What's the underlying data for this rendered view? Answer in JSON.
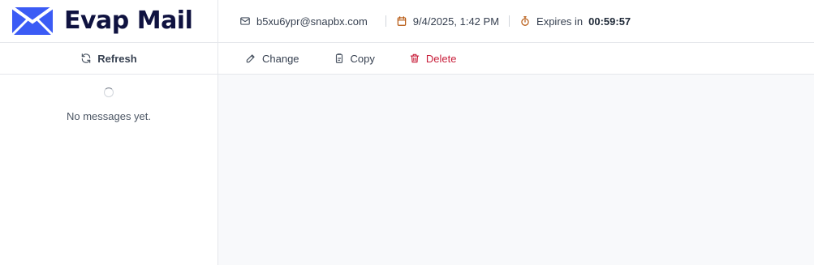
{
  "brand": {
    "name": "Evap Mail",
    "logo_icon": "envelope-logo-icon",
    "logo_color": "#3b5bf5"
  },
  "header": {
    "email": "b5xu6ypr@snapbx.com",
    "created": "9/4/2025, 1:42 PM",
    "expires_label": "Expires in",
    "expires_countdown": "00:59:57",
    "calendar_color": "#b45309",
    "timer_color": "#b45309"
  },
  "sidebar": {
    "refresh_label": "Refresh",
    "empty_text": "No messages yet."
  },
  "toolbar": {
    "change_label": "Change",
    "copy_label": "Copy",
    "delete_label": "Delete",
    "delete_color": "#c81e3a"
  }
}
